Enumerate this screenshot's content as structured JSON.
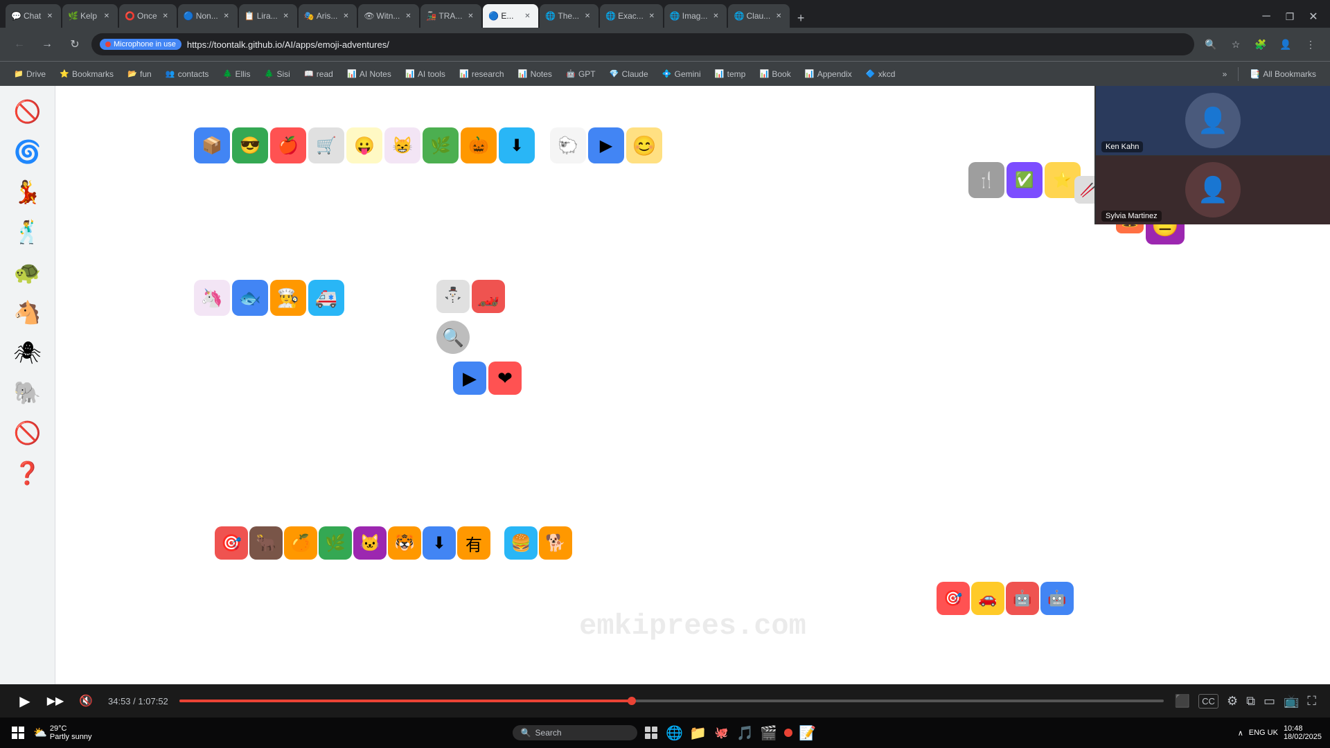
{
  "browser": {
    "tabs": [
      {
        "id": "chat",
        "label": "Chat",
        "favicon": "💬",
        "active": false
      },
      {
        "id": "kelp",
        "label": "Kelp",
        "favicon": "🌿",
        "active": false
      },
      {
        "id": "once",
        "label": "Once",
        "favicon": "⭕",
        "active": false
      },
      {
        "id": "non",
        "label": "Non...",
        "favicon": "🔵",
        "active": false
      },
      {
        "id": "lira",
        "label": "Lira...",
        "favicon": "📋",
        "active": false
      },
      {
        "id": "aris",
        "label": "Aris...",
        "favicon": "🎭",
        "active": false
      },
      {
        "id": "witn",
        "label": "Witn...",
        "favicon": "👁",
        "active": false
      },
      {
        "id": "tra",
        "label": "TRA...",
        "favicon": "🚂",
        "active": false
      },
      {
        "id": "e",
        "label": "E...",
        "favicon": "🔵",
        "active": true
      },
      {
        "id": "the",
        "label": "The...",
        "favicon": "🌐",
        "active": false
      },
      {
        "id": "exac",
        "label": "Exac...",
        "favicon": "🌐",
        "active": false
      },
      {
        "id": "imag",
        "label": "Imag...",
        "favicon": "🌐",
        "active": false
      },
      {
        "id": "clau",
        "label": "Clau...",
        "favicon": "🌐",
        "active": false
      }
    ],
    "url": "https://toontalk.github.io/AI/apps/emoji-adventures/",
    "mic_label": "Microphone in use"
  },
  "bookmarks": [
    {
      "label": "Drive",
      "icon": "📁"
    },
    {
      "label": "Bookmarks",
      "icon": "⭐"
    },
    {
      "label": "fun",
      "icon": "📂"
    },
    {
      "label": "contacts",
      "icon": "👥"
    },
    {
      "label": "Ellis",
      "icon": "🌲"
    },
    {
      "label": "Sisi",
      "icon": "🌲"
    },
    {
      "label": "read",
      "icon": "📖"
    },
    {
      "label": "AI Notes",
      "icon": "📊"
    },
    {
      "label": "AI tools",
      "icon": "📊"
    },
    {
      "label": "research",
      "icon": "📊"
    },
    {
      "label": "Notes",
      "icon": "📊"
    },
    {
      "label": "GPT",
      "icon": "🤖"
    },
    {
      "label": "Claude",
      "icon": "💎"
    },
    {
      "label": "Gemini",
      "icon": "💠"
    },
    {
      "label": "temp",
      "icon": "📊"
    },
    {
      "label": "Book",
      "icon": "📊"
    },
    {
      "label": "Appendix",
      "icon": "📊"
    },
    {
      "label": "xkcd",
      "icon": "🔷"
    },
    {
      "label": "All Bookmarks",
      "icon": "📑"
    }
  ],
  "sidebar": {
    "icons": [
      "🚫",
      "🌀",
      "💃",
      "🕺",
      "🐢",
      "🐴",
      "🕷",
      "🐘",
      "🚫",
      "❓"
    ]
  },
  "videoCall": {
    "person1": "Ken Kahn",
    "person2": "Sylvia Martinez"
  },
  "mediaPlayer": {
    "currentTime": "34:53",
    "totalTime": "1:07:52",
    "progressPercent": 46
  },
  "taskbar": {
    "weather": "29°C",
    "condition": "Partly sunny",
    "searchPlaceholder": "Search",
    "time": "10:48",
    "date": "18/02/2025",
    "lang": "ENG UK"
  },
  "once_tab_label": "Once"
}
